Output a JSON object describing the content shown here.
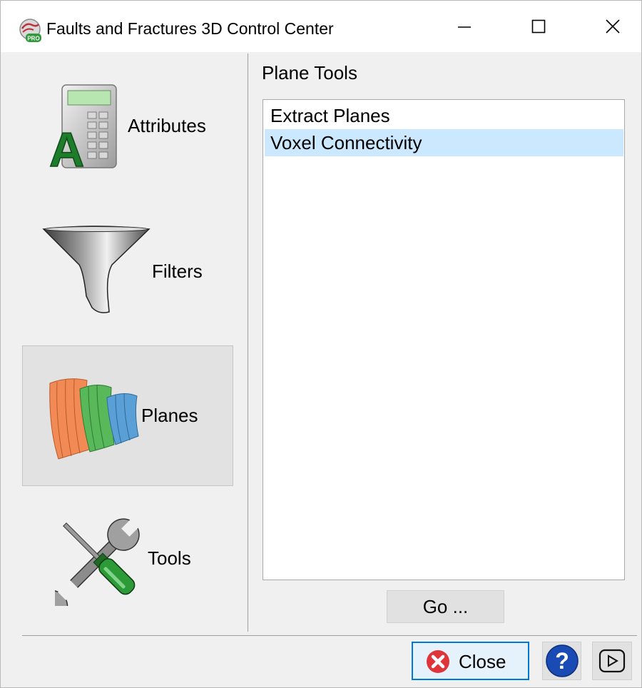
{
  "window": {
    "title": "Faults and Fractures 3D Control Center",
    "app_icon_badge": "PRO"
  },
  "nav": {
    "items": [
      {
        "label": "Attributes",
        "icon": "calculator-icon",
        "selected": false
      },
      {
        "label": "Filters",
        "icon": "funnel-icon",
        "selected": false
      },
      {
        "label": "Planes",
        "icon": "planes-icon",
        "selected": true
      },
      {
        "label": "Tools",
        "icon": "wrench-screwdriver-icon",
        "selected": false
      }
    ]
  },
  "panel": {
    "title": "Plane Tools",
    "list": [
      {
        "label": "Extract Planes",
        "selected": false
      },
      {
        "label": "Voxel Connectivity",
        "selected": true
      }
    ],
    "go_label": "Go ..."
  },
  "footer": {
    "close_label": "Close"
  },
  "colors": {
    "selection_bg": "#cce8ff",
    "focus_border": "#0078d7",
    "help_blue": "#1a4bb5",
    "close_red": "#e0343b"
  }
}
